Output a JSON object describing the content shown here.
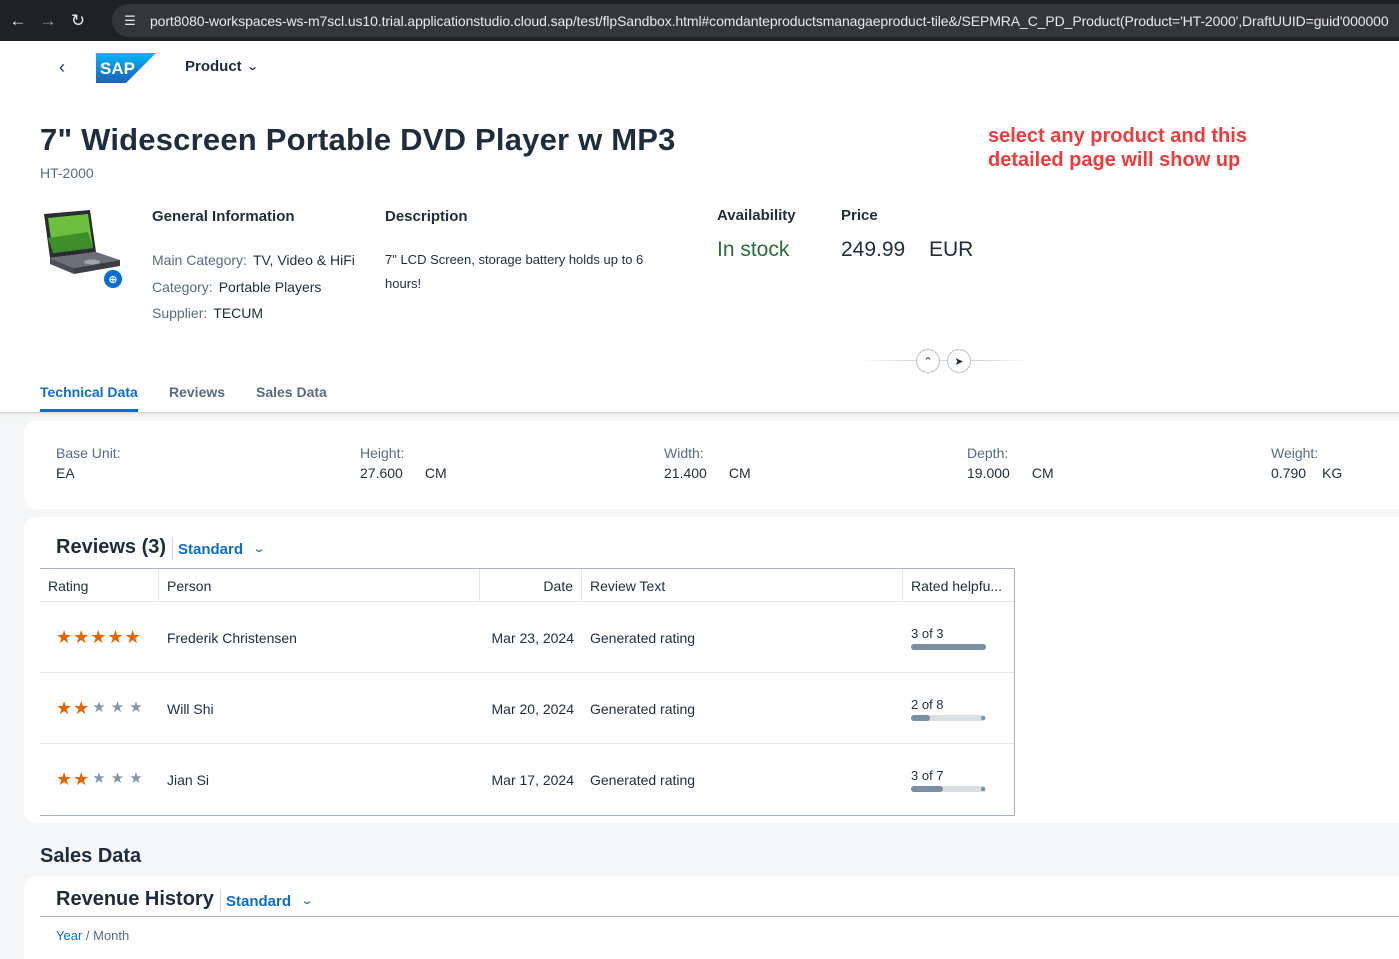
{
  "browser": {
    "url": "port8080-workspaces-ws-m7scl.us10.trial.applicationstudio.cloud.sap/test/flpSandbox.html#comdanteproductsmanagaeproduct-tile&/SEPMRA_C_PD_Product(Product='HT-2000',DraftUUID=guid'000000"
  },
  "shell": {
    "app_title": "Product"
  },
  "header": {
    "title": "7\" Widescreen Portable DVD Player w MP3",
    "subtitle": "HT-2000",
    "note": "select any product and this detailed page will show up",
    "general": {
      "title": "General Information",
      "main_category_label": "Main Category:",
      "main_category_value": "TV, Video & HiFi",
      "category_label": "Category:",
      "category_value": "Portable Players",
      "supplier_label": "Supplier:",
      "supplier_value": "TECUM"
    },
    "description": {
      "title": "Description",
      "text": "7\" LCD Screen, storage battery holds up to 6 hours!"
    },
    "availability": {
      "title": "Availability",
      "value": "In stock"
    },
    "price": {
      "title": "Price",
      "value": "249.99",
      "currency": "EUR"
    }
  },
  "tabs": [
    "Technical Data",
    "Reviews",
    "Sales Data"
  ],
  "technical": {
    "base_unit_label": "Base Unit:",
    "base_unit_value": "EA",
    "height_label": "Height:",
    "height_value": "27.600",
    "height_unit": "CM",
    "width_label": "Width:",
    "width_value": "21.400",
    "width_unit": "CM",
    "depth_label": "Depth:",
    "depth_value": "19.000",
    "depth_unit": "CM",
    "weight_label": "Weight:",
    "weight_value": "0.790",
    "weight_unit": "KG"
  },
  "reviews": {
    "title": "Reviews (3)",
    "variant": "Standard",
    "columns": [
      "Rating",
      "Person",
      "Date",
      "Review Text",
      "Rated helpfu..."
    ],
    "rows": [
      {
        "rating": 5,
        "person": "Frederik Christensen",
        "date": "Mar 23, 2024",
        "text": "Generated rating",
        "helpful": "3 of 3",
        "helpful_fraction": 1.0
      },
      {
        "rating": 2,
        "person": "Will Shi",
        "date": "Mar 20, 2024",
        "text": "Generated rating",
        "helpful": "2 of 8",
        "helpful_fraction": 0.25
      },
      {
        "rating": 2,
        "person": "Jian Si",
        "date": "Mar 17, 2024",
        "text": "Generated rating",
        "helpful": "3 of 7",
        "helpful_fraction": 0.43
      }
    ]
  },
  "sales": {
    "heading": "Sales Data",
    "revenue_title": "Revenue History",
    "variant": "Standard",
    "crumb_year": "Year",
    "crumb_sep": " / ",
    "crumb_month": "Month"
  },
  "icons": {
    "back": "arrow-left-icon",
    "forward": "arrow-right-icon",
    "reload": "reload-icon",
    "site_settings": "tune-icon",
    "zoom": "zoom-in-icon",
    "collapse": "chevron-up-icon",
    "pin": "pin-icon"
  },
  "colors": {
    "accent": "#0a6ed1",
    "in_stock": "#256f3a",
    "note": "#ee3b3b",
    "star": "#e76500"
  }
}
